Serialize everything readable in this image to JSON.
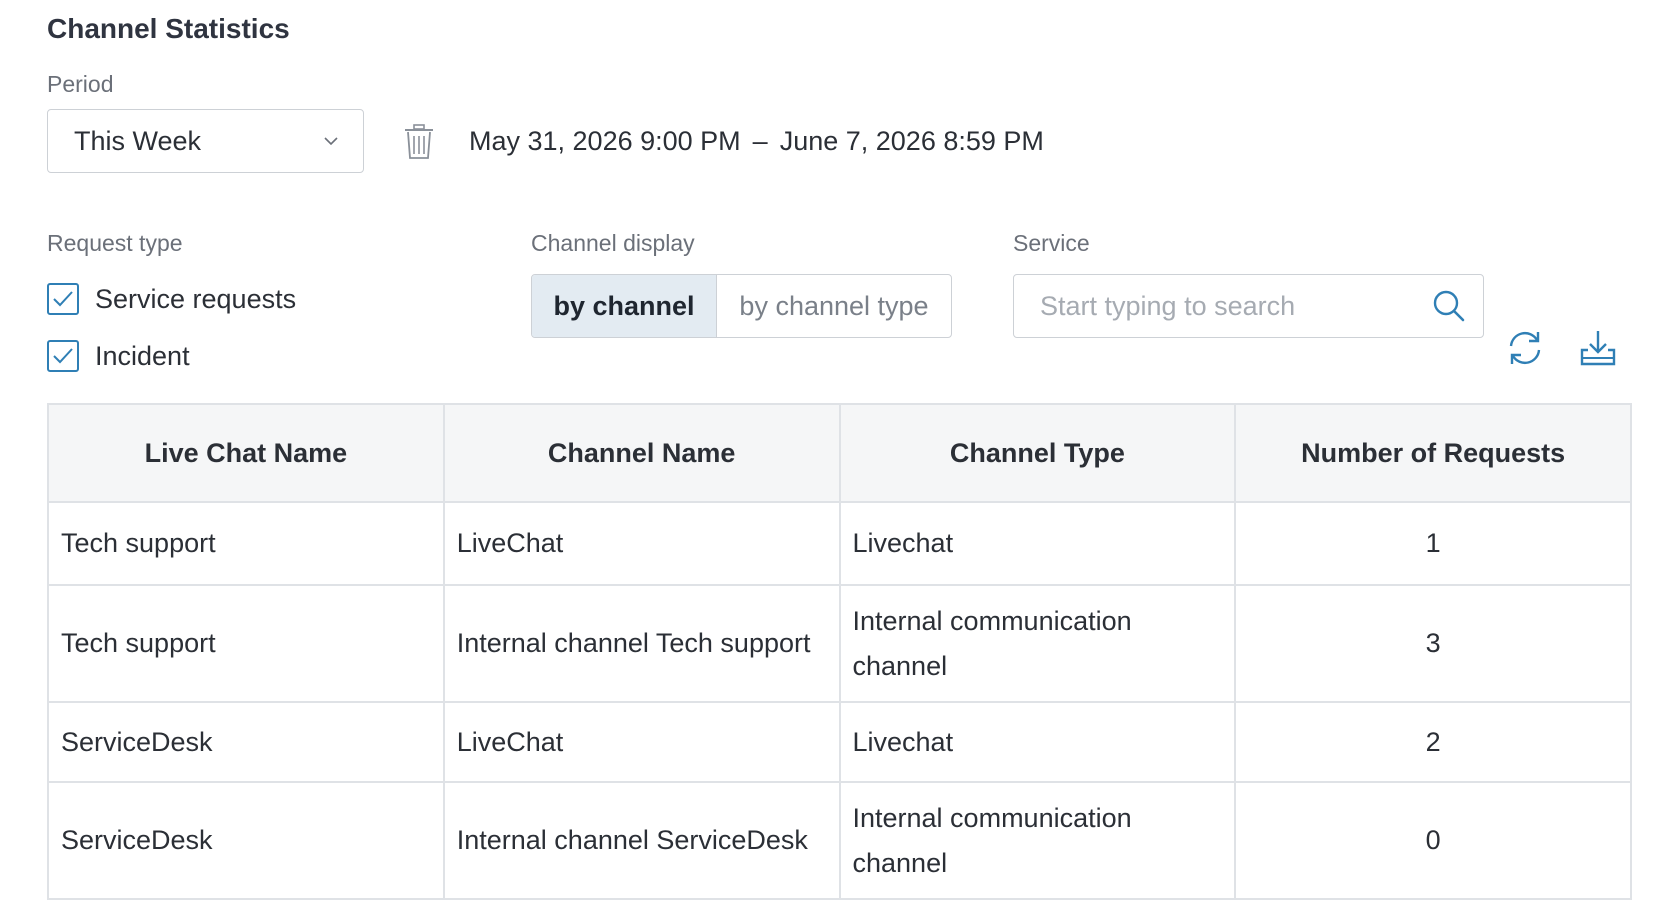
{
  "title": "Channel Statistics",
  "period": {
    "label": "Period",
    "selected": "This Week",
    "range_start": "May 31, 2026 9:00 PM",
    "range_separator": "–",
    "range_end": "June 7, 2026 8:59 PM"
  },
  "request_type": {
    "label": "Request type",
    "options": [
      {
        "label": "Service requests",
        "checked": true
      },
      {
        "label": "Incident",
        "checked": true
      }
    ]
  },
  "channel_display": {
    "label": "Channel display",
    "options": [
      "by channel",
      "by channel type"
    ],
    "selected": "by channel"
  },
  "service": {
    "label": "Service",
    "placeholder": "Start typing to search",
    "value": ""
  },
  "icons": {
    "chevron": "chevron-down-icon",
    "trash": "trash-icon",
    "search": "search-icon",
    "refresh": "refresh-icon",
    "download": "download-icon"
  },
  "colors": {
    "accent": "#2f7fb5",
    "active_segment_bg": "#e3ebf2",
    "header_bg": "#f5f6f7",
    "border": "#dfe2e6"
  },
  "table": {
    "columns": [
      "Live Chat Name",
      "Channel Name",
      "Channel Type",
      "Number of Requests"
    ],
    "rows": [
      {
        "live_chat": "Tech support",
        "channel": "LiveChat",
        "type": "Livechat",
        "count": "1"
      },
      {
        "live_chat": "Tech support",
        "channel": "Internal channel Tech support",
        "type": "Internal communication channel",
        "count": "3"
      },
      {
        "live_chat": "ServiceDesk",
        "channel": "LiveChat",
        "type": "Livechat",
        "count": "2"
      },
      {
        "live_chat": "ServiceDesk",
        "channel": "Internal channel ServiceDesk",
        "type": "Internal communication channel",
        "count": "0"
      }
    ]
  }
}
